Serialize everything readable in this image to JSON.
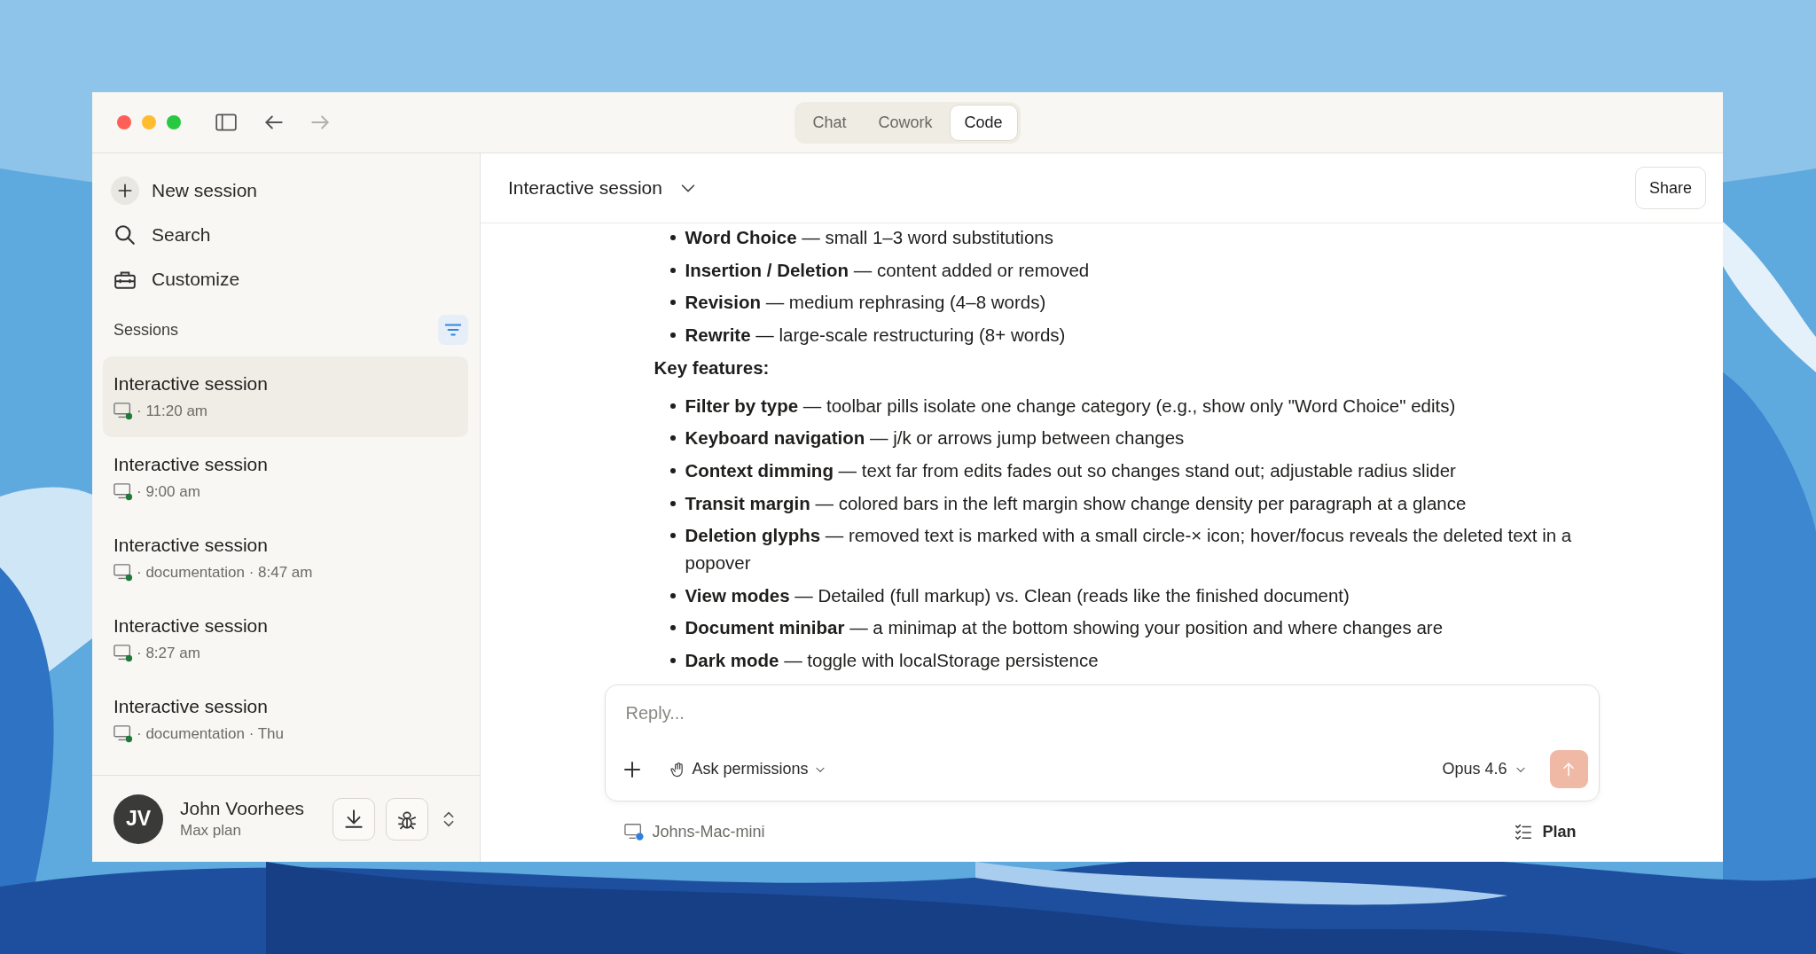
{
  "mode_tabs": [
    {
      "label": "Chat",
      "selected": false
    },
    {
      "label": "Cowork",
      "selected": false
    },
    {
      "label": "Code",
      "selected": true
    }
  ],
  "sidebar": {
    "actions": [
      "New session",
      "Search",
      "Customize"
    ],
    "sessions_label": "Sessions",
    "sessions": [
      {
        "title": "Interactive session",
        "meta": "· 11:20 am",
        "selected": true
      },
      {
        "title": "Interactive session",
        "meta": "· 9:00 am",
        "selected": false
      },
      {
        "title": "Interactive session",
        "meta": "· documentation · 8:47 am",
        "selected": false
      },
      {
        "title": "Interactive session",
        "meta": "· 8:27 am",
        "selected": false
      },
      {
        "title": "Interactive session",
        "meta": "· documentation · Thu",
        "selected": false
      }
    ],
    "user": {
      "initials": "JV",
      "name": "John Voorhees",
      "plan": "Max plan"
    }
  },
  "header": {
    "title": "Interactive session",
    "share": "Share"
  },
  "message": [
    {
      "kind": "list",
      "items": [
        "**Word Choice** — small 1–3 word substitutions",
        "**Insertion / Deletion** — content added or removed",
        "**Revision** — medium rephrasing (4–8 words)",
        "**Rewrite** — large-scale restructuring (8+ words)"
      ]
    },
    {
      "kind": "heading",
      "text": "Key features:"
    },
    {
      "kind": "list",
      "items": [
        "**Filter by type** — toolbar pills isolate one change category (e.g., show only \"Word Choice\" edits)",
        "**Keyboard navigation** — j/k or arrows jump between changes",
        "**Context dimming** — text far from edits fades out so changes stand out; adjustable radius slider",
        "**Transit margin** — colored bars in the left margin show change density per paragraph at a glance",
        "**Deletion glyphs** — removed text is marked with a small circle-× icon; hover/focus reveals the deleted text in a popover",
        "**View modes** — Detailed (full markup) vs. Clean (reads like the finished document)",
        "**Document minibar** — a minimap at the bottom showing your position and where changes are",
        "**Dark mode** — toggle with localStorage persistence"
      ]
    }
  ],
  "composer": {
    "placeholder": "Reply...",
    "permissions": "Ask permissions",
    "model": "Opus 4.6",
    "send_disabled": true
  },
  "footer": {
    "machine": "Johns-Mac-mini",
    "plan": "Plan"
  }
}
